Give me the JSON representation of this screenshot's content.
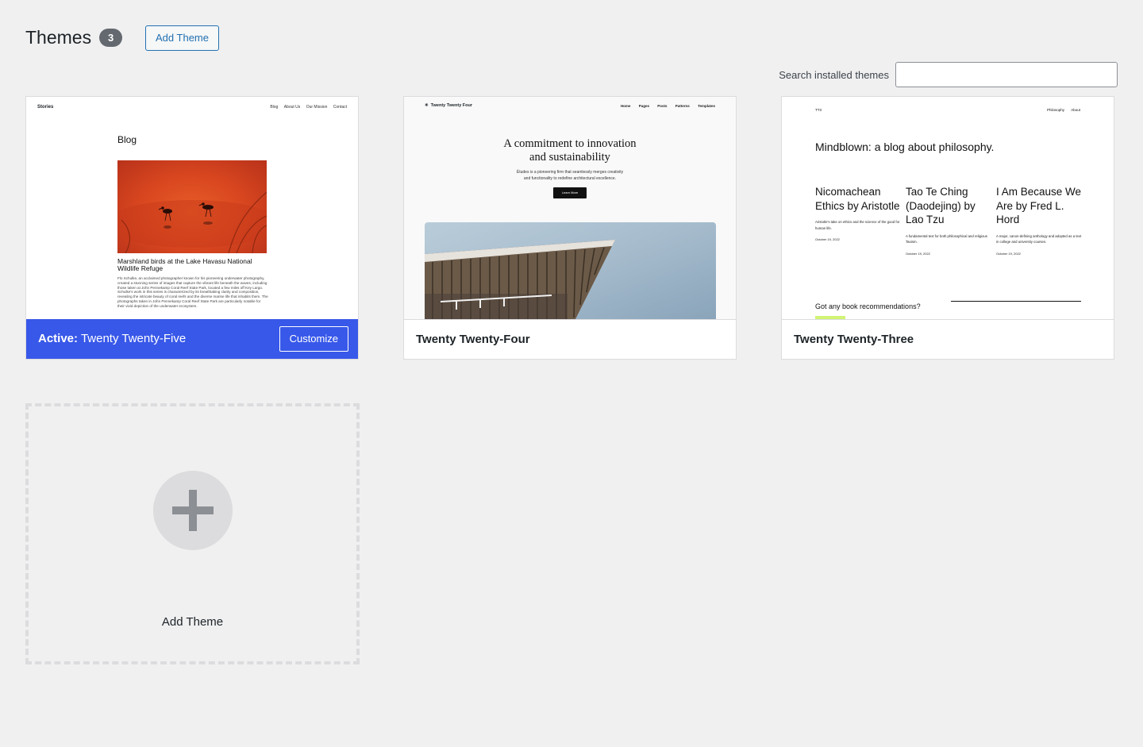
{
  "header": {
    "title": "Themes",
    "count": "3",
    "add_button_label": "Add Theme"
  },
  "search": {
    "label": "Search installed themes",
    "value": "",
    "placeholder": ""
  },
  "themes": [
    {
      "name": "Twenty Twenty-Five",
      "active_prefix": "Active:",
      "customize_label": "Customize",
      "preview": {
        "site_title": "Stories",
        "nav": [
          "Blog",
          "About Us",
          "Our Mission",
          "Contact"
        ],
        "heading": "Blog",
        "caption": "Marshland birds at the Lake Havasu National Wildlife Refuge",
        "body": "Flo Schulke, an acclaimed photographer known for his pioneering underwater photography, created a stunning series of images that capture the vibrant life beneath the waves, including those taken at John Pennekamp Coral Reef State Park, located a few miles off Key Largo. Schulke's work in this series is characterized by its breathtaking clarity and composition, revealing the intricate beauty of coral reefs and the diverse marine life that inhabits them. The photographs taken in John Pennekamp Coral Reef State Park are particularly notable for their vivid depiction of the underwater ecosystem."
      }
    },
    {
      "name": "Twenty Twenty-Four",
      "preview": {
        "site_title": "Twenty Twenty Four",
        "nav": [
          "Home",
          "Pages",
          "Posts",
          "Patterns",
          "Templates"
        ],
        "heading_line1": "A commitment to innovation",
        "heading_line2": "and sustainability",
        "body_line1": "Études is a pioneering firm that seamlessly merges creativity",
        "body_line2": "and functionality to redefine architectural excellence.",
        "button": "Learn More"
      }
    },
    {
      "name": "Twenty Twenty-Three",
      "preview": {
        "site_title": "TT3",
        "nav": [
          "Philosophy",
          "About"
        ],
        "heading": "Mindblown: a blog about philosophy.",
        "posts": [
          {
            "title": "Nicomachean Ethics by Aristotle",
            "desc": "Aristotle's take on ethics and the science of the good for human life.",
            "date": "October 19, 2022"
          },
          {
            "title": "Tao Te Ching (Daodejing) by Lao Tzu",
            "desc": "A fundamental text for both philosophical and religious Taoism.",
            "date": "October 19, 2022"
          },
          {
            "title": "I Am Because We Are by Fred L. Hord",
            "desc": "A major, canon-defining anthology and adopted as a text in college and university courses.",
            "date": "October 19, 2022"
          }
        ],
        "question": "Got any book recommendations?"
      }
    }
  ],
  "add_tile": {
    "label": "Add Theme"
  },
  "colors": {
    "accent": "#3858e9",
    "link": "#2271b1",
    "background": "#f0f0f1",
    "badge": "#646970"
  }
}
